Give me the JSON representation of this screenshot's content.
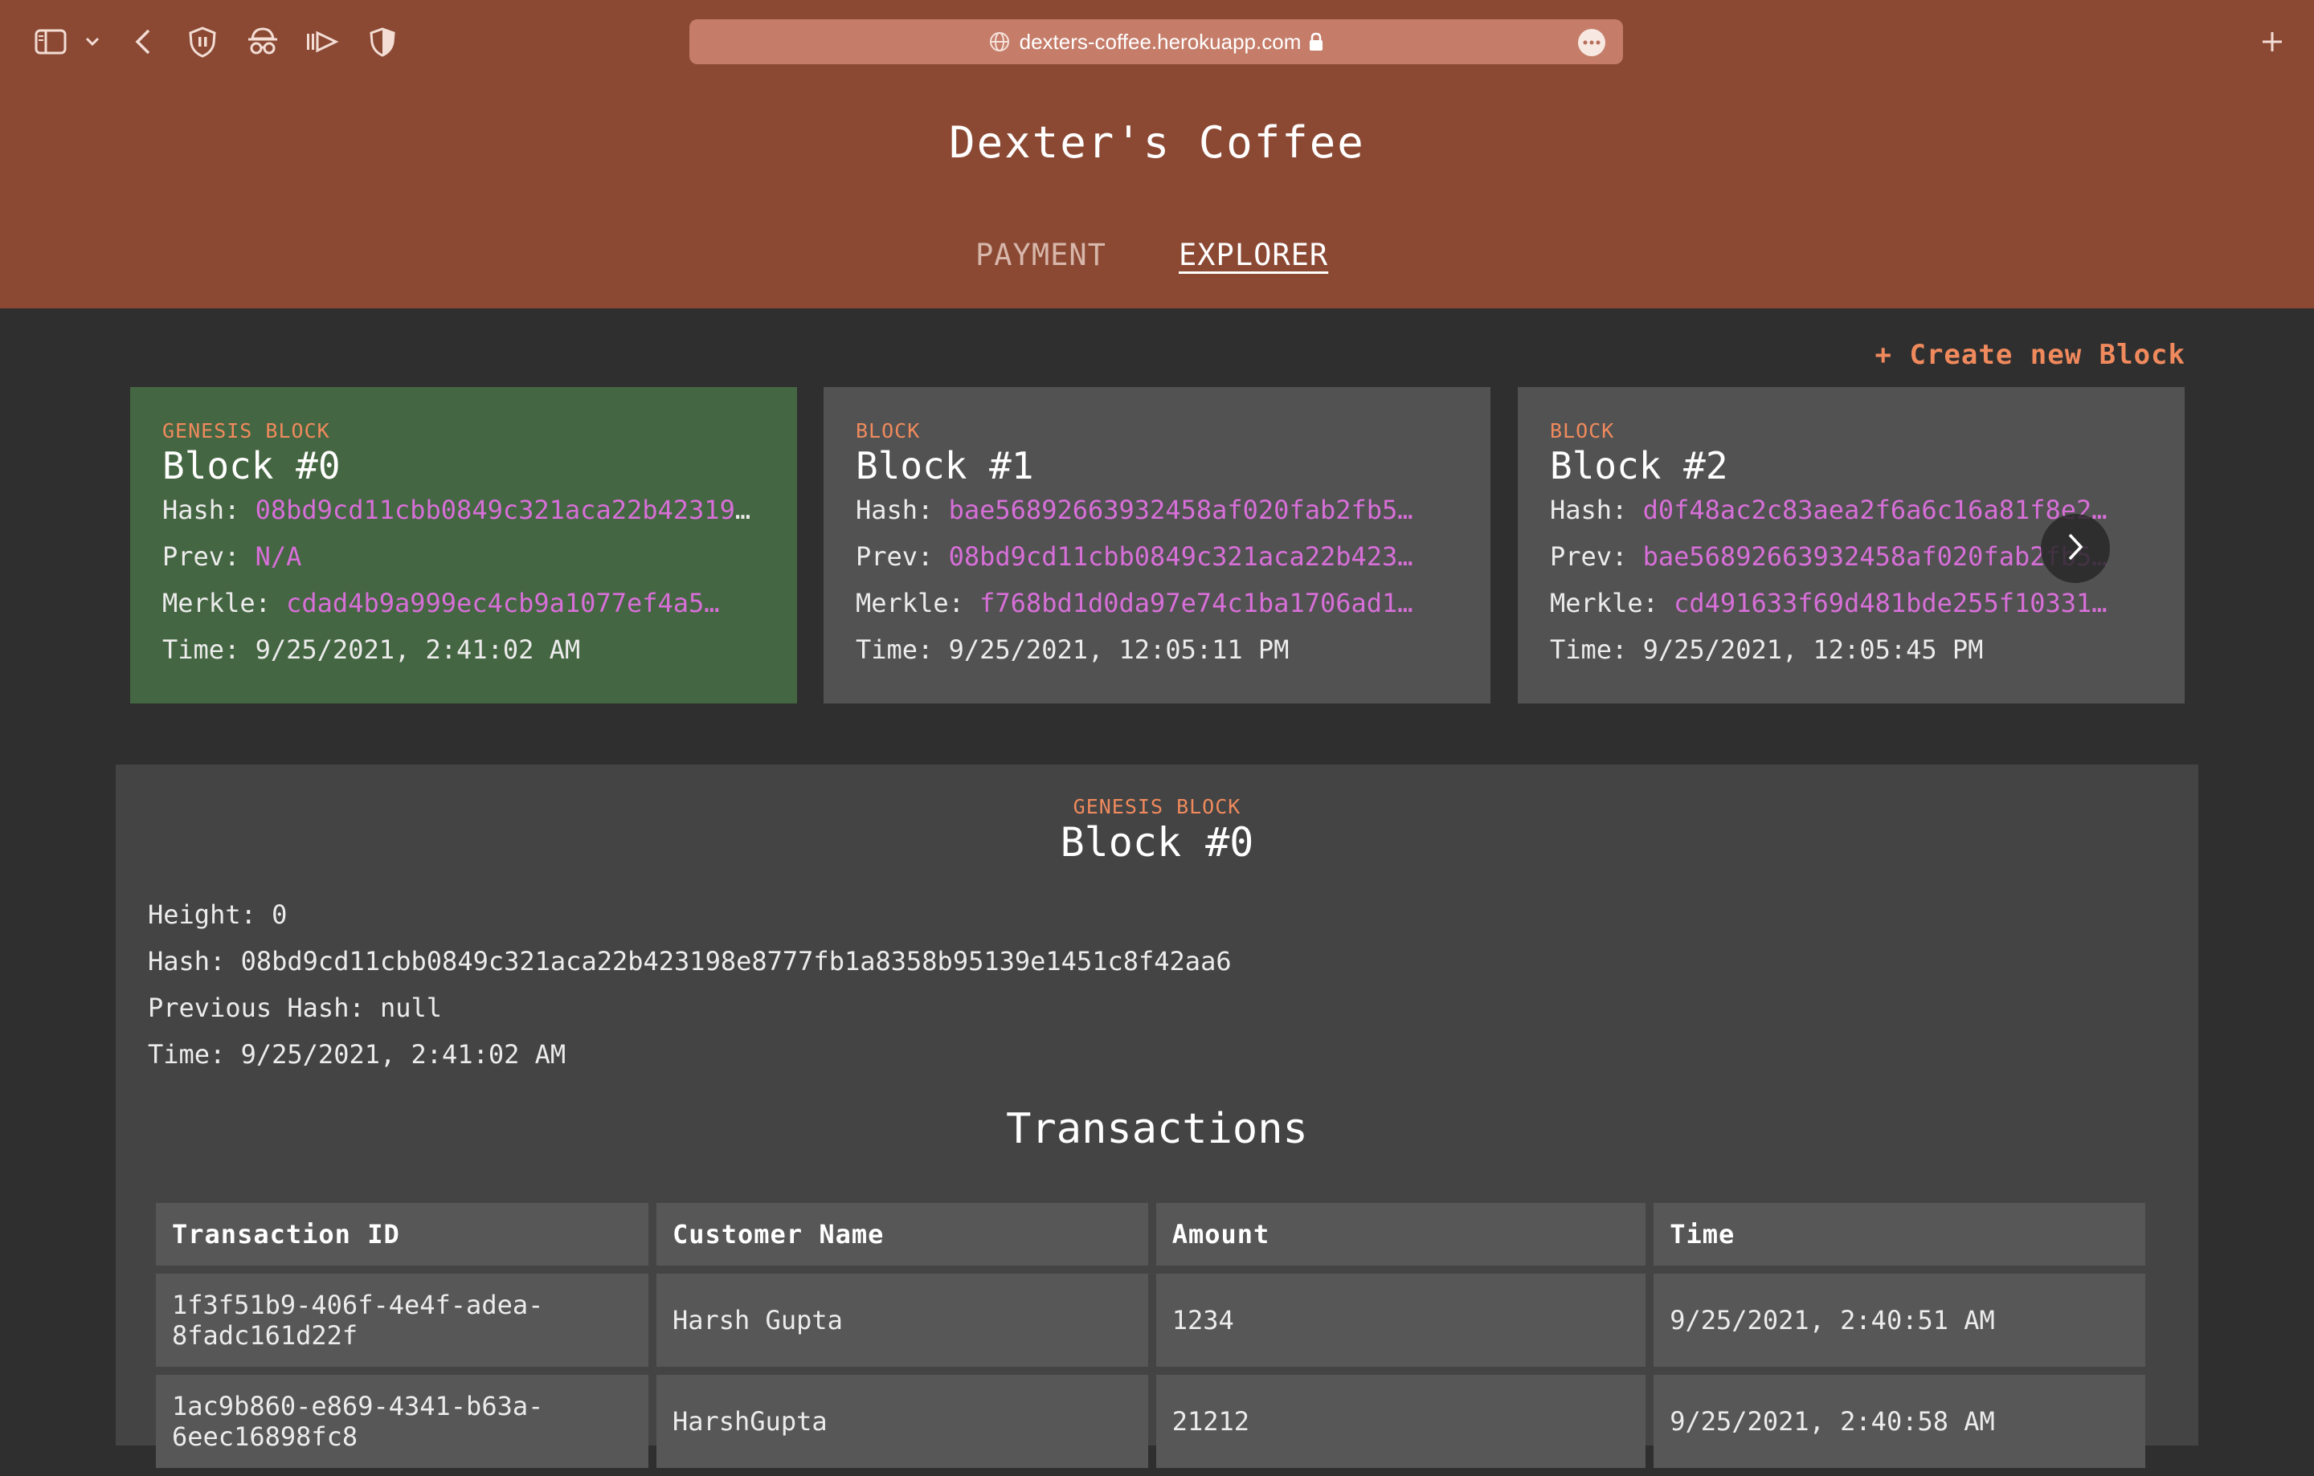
{
  "browser": {
    "url": "dexters-coffee.herokuapp.com",
    "toolbar_icons": [
      "sidebar-icon",
      "chevron-down-icon",
      "back-arrow-icon",
      "shield-extension-icon",
      "spy-extension-icon",
      "play-extension-icon",
      "half-shield-extension-icon"
    ],
    "new_tab_icon": "plus-icon"
  },
  "header": {
    "title": "Dexter's Coffee",
    "nav": {
      "payment": "PAYMENT",
      "explorer": "EXPLORER"
    }
  },
  "explorer": {
    "create_label": "+ Create new Block",
    "blocks": [
      {
        "type": "GENESIS BLOCK",
        "title": "Block #0",
        "hash_label": "Hash:",
        "hash": "08bd9cd11cbb0849c321aca22b423198e8777fb1a8358b95139e1451c8f42aa6",
        "prev_label": "Prev:",
        "prev": "N/A",
        "merkle_label": "Merkle:",
        "merkle": "cdad4b9a999ec4cb9a1077ef4a5…",
        "time_label": "Time:",
        "time": "9/25/2021, 2:41:02 AM"
      },
      {
        "type": "BLOCK",
        "title": "Block #1",
        "hash_label": "Hash:",
        "hash": "bae56892663932458af020fab2fb5…",
        "prev_label": "Prev:",
        "prev": "08bd9cd11cbb0849c321aca22b423…",
        "merkle_label": "Merkle:",
        "merkle": "f768bd1d0da97e74c1ba1706ad1…",
        "time_label": "Time:",
        "time": "9/25/2021, 12:05:11 PM"
      },
      {
        "type": "BLOCK",
        "title": "Block #2",
        "hash_label": "Hash:",
        "hash": "d0f48ac2c83aea2f6a6c16a81f8e2…",
        "prev_label": "Prev:",
        "prev": "bae56892663932458af020fab2fb5…",
        "merkle_label": "Merkle:",
        "merkle": "cd491633f69d481bde255f10331…",
        "time_label": "Time:",
        "time": "9/25/2021, 12:05:45 PM"
      }
    ]
  },
  "detail": {
    "type": "GENESIS BLOCK",
    "title": "Block #0",
    "height": "Height: 0",
    "hash": "Hash: 08bd9cd11cbb0849c321aca22b423198e8777fb1a8358b95139e1451c8f42aa6",
    "previous_hash": "Previous Hash: null",
    "time": "Time: 9/25/2021, 2:41:02 AM",
    "transactions_title": "Transactions",
    "columns": [
      "Transaction ID",
      "Customer Name",
      "Amount",
      "Time"
    ],
    "rows": [
      {
        "id": "1f3f51b9-406f-4e4f-adea-8fadc161d22f",
        "name": "Harsh Gupta",
        "amount": "1234",
        "time": "9/25/2021, 2:40:51 AM"
      },
      {
        "id": "1ac9b860-e869-4341-b63a-6eec16898fc8",
        "name": "HarshGupta",
        "amount": "21212",
        "time": "9/25/2021, 2:40:58 AM"
      }
    ]
  },
  "colors": {
    "header": "#8b4934",
    "background": "#2f2f2f",
    "genesis_card": "#456642",
    "card": "#525252",
    "accent": "#f08a5d",
    "hash": "#d76fd8"
  }
}
